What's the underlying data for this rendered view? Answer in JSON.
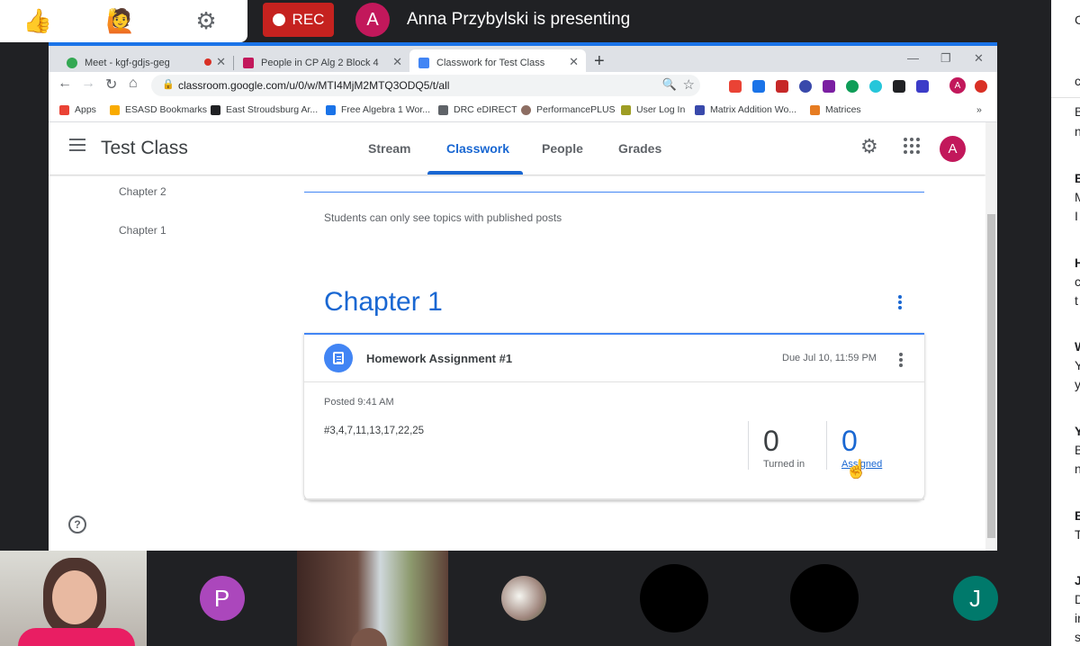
{
  "meet": {
    "controls": {
      "thumbs_icon": "👍",
      "raise_hand_icon": "🙋",
      "settings_icon": "⚙"
    },
    "rec_label": "REC",
    "presenter_initial": "A",
    "presenting_text": "Anna Przybylski is presenting"
  },
  "browser": {
    "tabs": [
      {
        "label": "Meet - kgf-gdjs-geg",
        "color": "#34a853"
      },
      {
        "label": "People in CP Alg 2 Block 4",
        "color": "#c2185b"
      },
      {
        "label": "Classwork for Test Class",
        "color": "#4285f4"
      }
    ],
    "url": "classroom.google.com/u/0/w/MTI4MjM2MTQ3ODQ5/t/all",
    "profile_initial": "A",
    "bookmarks": [
      {
        "label": "Apps",
        "color": "#ea4335"
      },
      {
        "label": "ESASD Bookmarks",
        "color": "#f9ab00"
      },
      {
        "label": "East Stroudsburg Ar...",
        "color": "#202124"
      },
      {
        "label": "Free Algebra 1 Wor...",
        "color": "#1a73e8"
      },
      {
        "label": "DRC eDIRECT",
        "color": "#5f6368"
      },
      {
        "label": "PerformancePLUS",
        "color": "#8d6e63"
      },
      {
        "label": "User Log In",
        "color": "#9e9d24"
      },
      {
        "label": "Matrix Addition Wo...",
        "color": "#3949ab"
      },
      {
        "label": "Matrices",
        "color": "#e67c22"
      }
    ],
    "bookmarks_overflow": "»"
  },
  "classroom": {
    "class_title": "Test Class",
    "nav_tabs": [
      "Stream",
      "Classwork",
      "People",
      "Grades"
    ],
    "active_tab": "Classwork",
    "avatar_initial": "A",
    "sidebar_topics": [
      "Chapter 2",
      "Chapter 1"
    ],
    "hint": "Students can only see topics with published posts",
    "topic": {
      "heading": "Chapter 1",
      "assignment": {
        "title": "Homework Assignment #1",
        "due": "Due Jul 10, 11:59 PM",
        "posted": "Posted 9:41 AM",
        "description": "#3,4,7,11,13,17,22,25",
        "turned_in_count": "0",
        "turned_in_label": "Turned in",
        "assigned_count": "0",
        "assigned_label": "Assigned"
      }
    }
  },
  "participants": [
    {
      "initial": "P",
      "color": "#ab47bc"
    },
    {
      "initial": "",
      "color": "#000000"
    },
    {
      "initial": "",
      "color": "#000000"
    },
    {
      "initial": "J",
      "color": "#00796b"
    }
  ],
  "chat": {
    "fragments": [
      "C",
      "c",
      "B",
      "n",
      "B",
      "M",
      "I",
      "H",
      "c",
      "t",
      "W",
      "Y",
      "y",
      "Y",
      "B",
      "n",
      "B",
      "T",
      "J",
      "D",
      "ir",
      "s"
    ]
  }
}
